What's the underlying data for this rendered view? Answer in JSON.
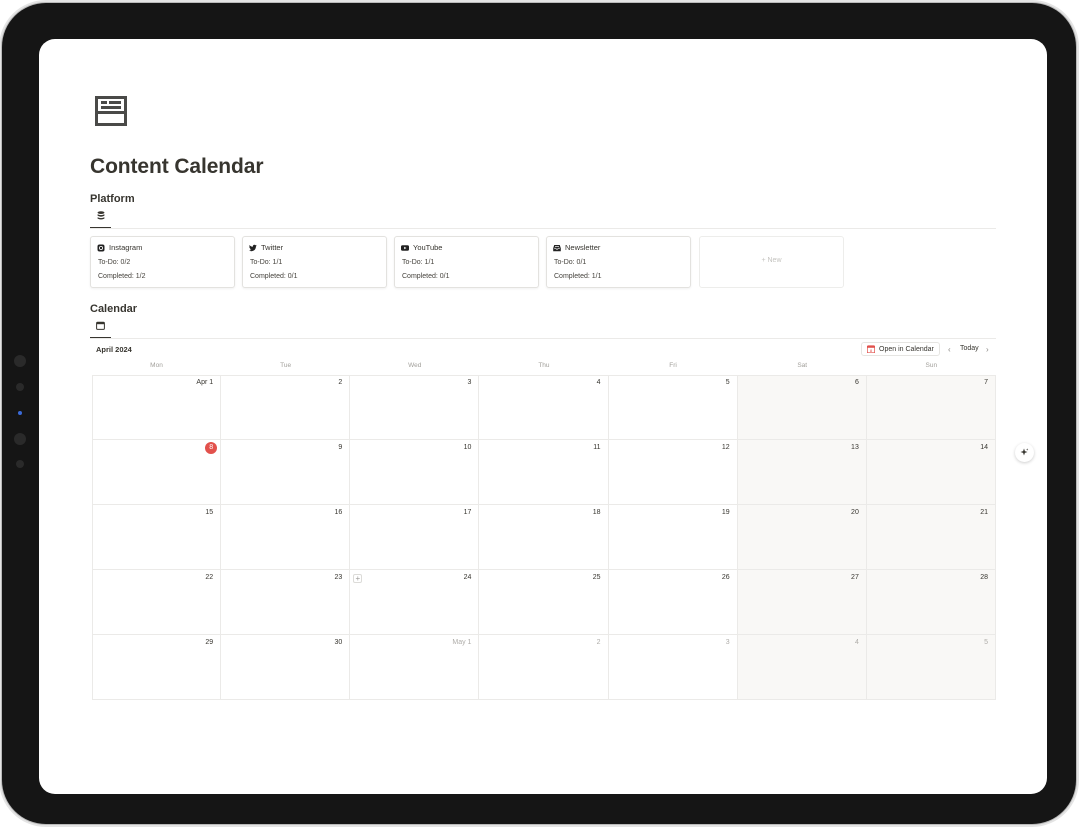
{
  "page": {
    "title": "Content Calendar",
    "icon": "layout-template-icon"
  },
  "platform": {
    "heading": "Platform",
    "view_icon": "database-icon",
    "cards": [
      {
        "name": "Instagram",
        "icon": "instagram-icon",
        "todo": "To-Do: 0/2",
        "completed": "Completed: 1/2"
      },
      {
        "name": "Twitter",
        "icon": "twitter-icon",
        "todo": "To-Do: 1/1",
        "completed": "Completed: 0/1"
      },
      {
        "name": "YouTube",
        "icon": "youtube-icon",
        "todo": "To-Do: 1/1",
        "completed": "Completed: 0/1"
      },
      {
        "name": "Newsletter",
        "icon": "inbox-icon",
        "todo": "To-Do: 0/1",
        "completed": "Completed: 1/1"
      }
    ],
    "new_label": "+ New"
  },
  "calendar": {
    "heading": "Calendar",
    "view_icon": "calendar-icon",
    "month": "April 2024",
    "open_label": "Open in Calendar",
    "today_label": "Today",
    "weekdays": [
      "Mon",
      "Tue",
      "Wed",
      "Thu",
      "Fri",
      "Sat",
      "Sun"
    ],
    "weeks": [
      [
        "Apr 1",
        "2",
        "3",
        "4",
        "5",
        "6",
        "7"
      ],
      [
        "8",
        "9",
        "10",
        "11",
        "12",
        "13",
        "14"
      ],
      [
        "15",
        "16",
        "17",
        "18",
        "19",
        "20",
        "21"
      ],
      [
        "22",
        "23",
        "24",
        "25",
        "26",
        "27",
        "28"
      ],
      [
        "29",
        "30",
        "May 1",
        "2",
        "3",
        "4",
        "5"
      ]
    ],
    "today": "8",
    "colors": {
      "today": "#e2514c",
      "weekend": "#f9f8f6"
    }
  }
}
